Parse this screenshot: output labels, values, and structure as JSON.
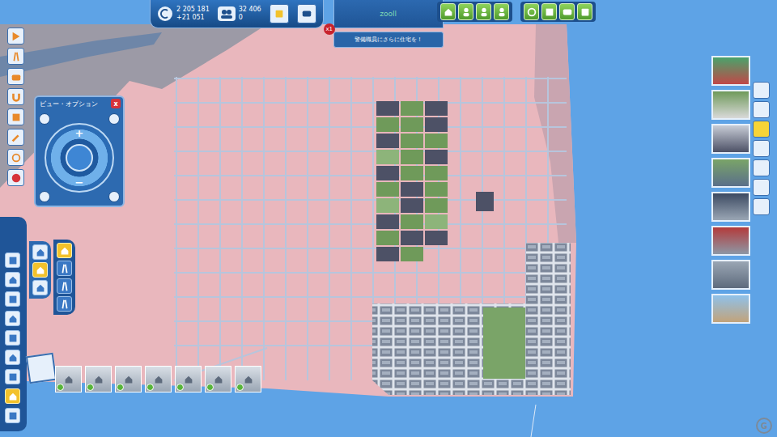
{
  "top_bar": {
    "money": "2 205 181",
    "money_delta": "+21 051",
    "population": "32 406",
    "population_delta": "0",
    "player": "zooll",
    "notification_count": "x1",
    "notification": "警備職員にさらに住宅を！"
  },
  "view_options": {
    "title": "ビュー・オプション",
    "close": "x",
    "zoom_in": "+",
    "zoom_out": "−"
  },
  "build_menu": {
    "categories": [
      {
        "selected": false
      },
      {
        "selected": false
      },
      {
        "selected": false
      },
      {
        "selected": false
      },
      {
        "selected": false
      },
      {
        "selected": false
      },
      {
        "selected": false
      },
      {
        "selected": true
      },
      {
        "selected": false
      }
    ],
    "subcategories": [
      {
        "selected": false
      },
      {
        "selected": true
      },
      {
        "selected": false
      }
    ],
    "tabs": [
      {
        "selected": true
      },
      {
        "selected": false
      },
      {
        "selected": false
      },
      {
        "selected": false
      }
    ],
    "buildings": [
      {
        "available": true
      },
      {
        "available": true
      },
      {
        "available": true
      },
      {
        "available": true
      },
      {
        "available": true
      },
      {
        "available": true
      },
      {
        "available": true
      }
    ]
  },
  "watermark": "G"
}
